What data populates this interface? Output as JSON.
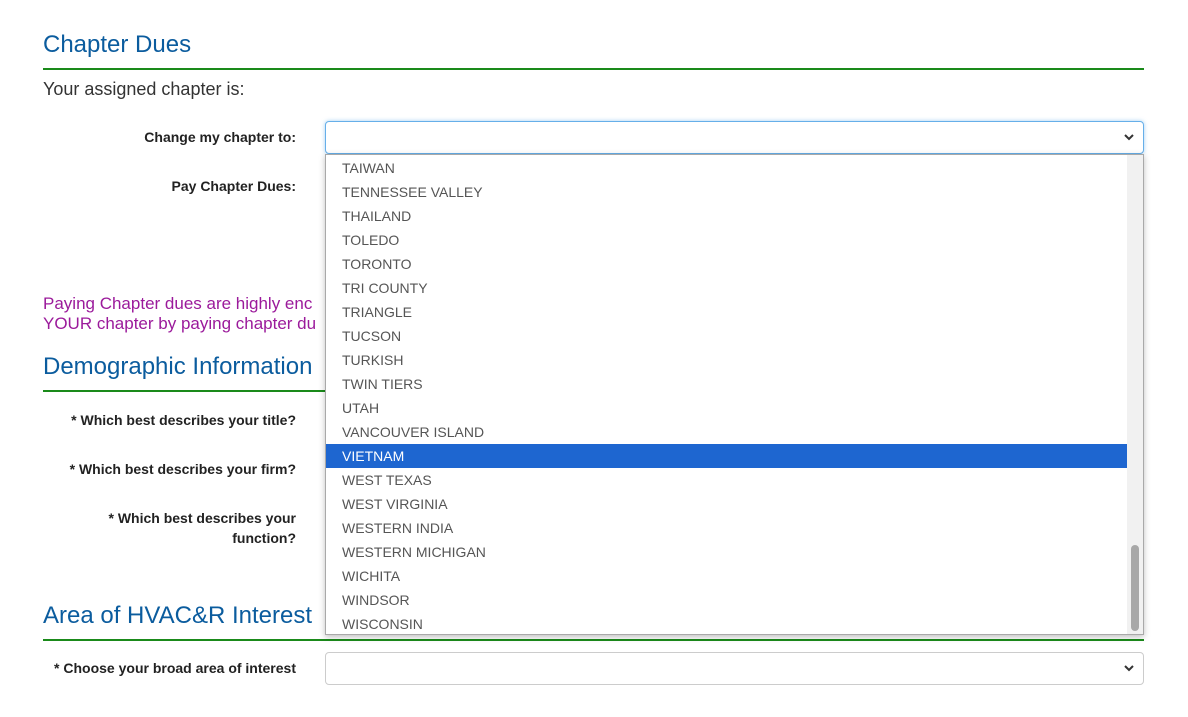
{
  "chapter_dues": {
    "title": "Chapter Dues",
    "assigned_text": "Your assigned chapter is:",
    "change_label": "Change my chapter to:",
    "change_value": "",
    "pay_label": "Pay Chapter Dues:",
    "notice_line1": "Paying Chapter dues are highly enc",
    "notice_line2": "YOUR chapter by paying chapter du"
  },
  "chapter_dropdown": {
    "options": [
      "TAIWAN",
      "TENNESSEE VALLEY",
      "THAILAND",
      "TOLEDO",
      "TORONTO",
      "TRI COUNTY",
      "TRIANGLE",
      "TUCSON",
      "TURKISH",
      "TWIN TIERS",
      "UTAH",
      "VANCOUVER ISLAND",
      "VIETNAM",
      "WEST TEXAS",
      "WEST VIRGINIA",
      "WESTERN INDIA",
      "WESTERN MICHIGAN",
      "WICHITA",
      "WINDSOR",
      "WISCONSIN"
    ],
    "highlighted": "VIETNAM"
  },
  "demographic": {
    "title": "Demographic Information",
    "title_q": "* Which best describes your title?",
    "firm_q": "* Which best describes your firm?",
    "function_q_line1": "* Which best describes your",
    "function_q_line2": "function?"
  },
  "interest": {
    "title": "Area of HVAC&R Interest",
    "broad_label": "* Choose your broad area of interest",
    "broad_value": ""
  },
  "colors": {
    "heading": "#0b5c9e",
    "rule": "#1a8a1a",
    "notice": "#9b1a9b",
    "highlight": "#1e66d0"
  },
  "icons": {
    "select_arrow": "chevron-down-icon"
  }
}
